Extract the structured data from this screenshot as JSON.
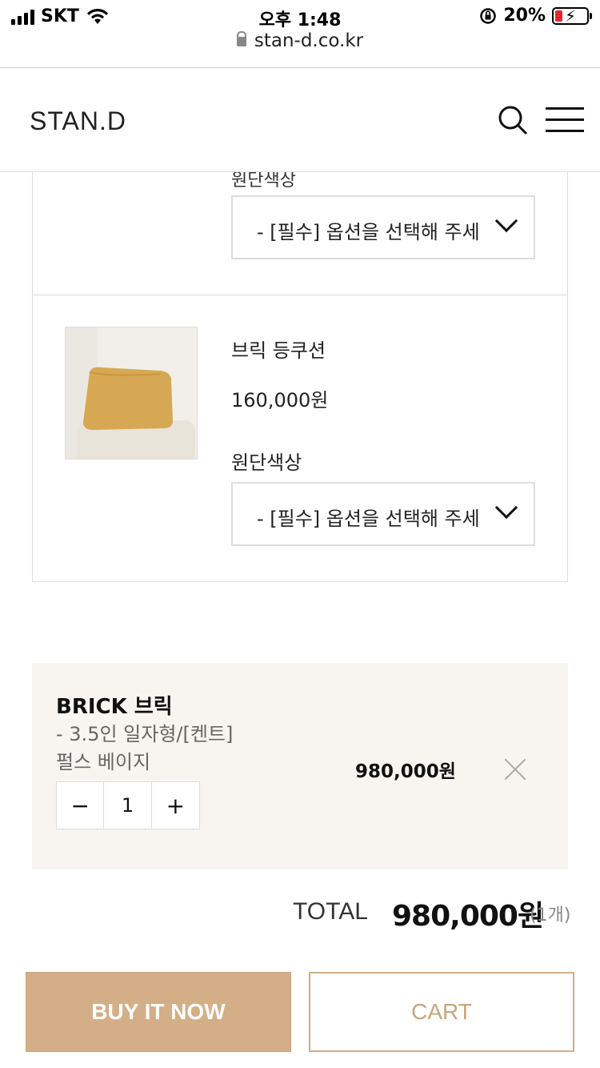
{
  "status_bar": {
    "carrier": "SKT",
    "time": "오후 1:48",
    "battery": "20%"
  },
  "browser": {
    "url": "stan-d.co.kr"
  },
  "header": {
    "logo": "STAN.D"
  },
  "options": {
    "cut_label": "원단색상",
    "select_placeholder": "- [필수] 옵션을 선택해 주세",
    "product": {
      "name": "브릭 등쿠션",
      "price": "160,000원",
      "option_label": "원단색상",
      "select_placeholder": "- [필수] 옵션을 선택해 주세"
    }
  },
  "cart_item": {
    "title": "BRICK 브릭",
    "option": "- 3.5인 일자형/[켄트] 펄스 베이지",
    "quantity": "1",
    "minus": "−",
    "plus": "+",
    "price": "980,000원"
  },
  "total": {
    "label": "TOTAL",
    "value": "980,000원",
    "count": "(1개)"
  },
  "actions": {
    "buy_now": "BUY IT NOW",
    "cart": "CART"
  },
  "colors": {
    "accent": "#d3ae87",
    "item_bg": "#f8f5f0",
    "battery_low": "#e0282e"
  }
}
